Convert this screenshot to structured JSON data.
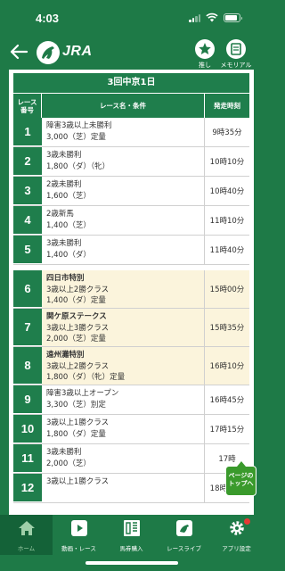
{
  "status": {
    "time": "4:03"
  },
  "header": {
    "logo_text": "JRA",
    "favorite_label": "推し",
    "memorial_label": "メモリアル"
  },
  "meeting": {
    "title": "3回中京1日"
  },
  "table": {
    "headers": {
      "num": "レース\n番号",
      "name": "レース名・条件",
      "time": "発走時刻"
    },
    "races": [
      {
        "num": "1",
        "name": "",
        "line1": "障害3歳以上未勝利",
        "line2": "3,000（芝）定量",
        "time": "9時35分",
        "special": false
      },
      {
        "num": "2",
        "name": "",
        "line1": "3歳未勝利",
        "line2": "1,800（ダ）（牝）",
        "time": "10時10分",
        "special": false
      },
      {
        "num": "3",
        "name": "",
        "line1": "2歳未勝利",
        "line2": "1,600（芝）",
        "time": "10時40分",
        "special": false
      },
      {
        "num": "4",
        "name": "",
        "line1": "2歳新馬",
        "line2": "1,400（芝）",
        "time": "11時10分",
        "special": false
      },
      {
        "num": "5",
        "name": "",
        "line1": "3歳未勝利",
        "line2": "1,400（ダ）",
        "time": "11時40分",
        "special": false
      },
      {
        "num": "6",
        "name": "四日市特別",
        "line1": "3歳以上2勝クラス",
        "line2": "1,400（ダ）定量",
        "time": "15時00分",
        "special": true
      },
      {
        "num": "7",
        "name": "関ケ原ステークス",
        "line1": "3歳以上3勝クラス",
        "line2": "2,000（芝）定量",
        "time": "15時35分",
        "special": true
      },
      {
        "num": "8",
        "name": "遠州灘特別",
        "line1": "3歳以上2勝クラス",
        "line2": "1,800（ダ）（牝）定量",
        "time": "16時10分",
        "special": true
      },
      {
        "num": "9",
        "name": "",
        "line1": "障害3歳以上オープン",
        "line2": "3,300（芝）別定",
        "time": "16時45分",
        "special": false
      },
      {
        "num": "10",
        "name": "",
        "line1": "3歳以上1勝クラス",
        "line2": "1,800（ダ）定量",
        "time": "17時15分",
        "special": false
      },
      {
        "num": "11",
        "name": "",
        "line1": "3歳未勝利",
        "line2": "2,000（芝）",
        "time": "17時",
        "special": false
      },
      {
        "num": "12",
        "name": "",
        "line1": "3歳以上1勝クラス",
        "line2": "",
        "time": "18時15分",
        "special": false
      }
    ]
  },
  "page_top": {
    "label": "ページの\nトップへ"
  },
  "nav": [
    {
      "label": "ホーム",
      "icon": "home-icon",
      "active": true
    },
    {
      "label": "動画・レース",
      "icon": "play-icon",
      "active": false
    },
    {
      "label": "馬券購入",
      "icon": "ticket-icon",
      "active": false
    },
    {
      "label": "レースライブ",
      "icon": "live-icon",
      "active": false
    },
    {
      "label": "アプリ設定",
      "icon": "gear-icon",
      "active": false
    }
  ],
  "colors": {
    "brand_green": "#1e7a47",
    "row_green": "#1f7e4c",
    "special_row": "#fbf4dc",
    "badge": "#e53935"
  }
}
